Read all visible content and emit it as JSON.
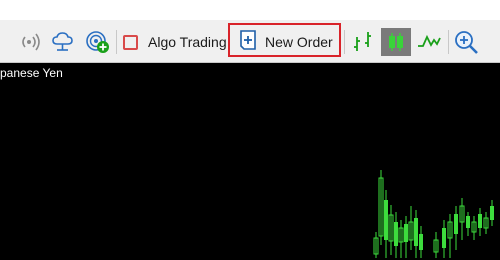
{
  "toolbar": {
    "algo_trading_label": "Algo Trading",
    "new_order_label": "New Order",
    "icons": {
      "signal": "signal-icon",
      "cloud": "cloud-icon",
      "vps": "vps-add-icon",
      "algo": "algo-trading-icon",
      "new_order": "new-order-icon",
      "bar_chart": "bar-chart-icon",
      "candlestick": "candlestick-chart-icon",
      "line_chart": "line-chart-icon",
      "zoom_in": "zoom-in-icon"
    },
    "colors": {
      "highlight_border": "#d9232a",
      "algo_icon_red": "#d94a4a",
      "chart_icon_green": "#1aa01a",
      "new_order_blue": "#1f5fa8"
    }
  },
  "chart": {
    "symbol_title": "panese Yen",
    "background": "#000000",
    "candle_color": "#3ddc3d"
  }
}
